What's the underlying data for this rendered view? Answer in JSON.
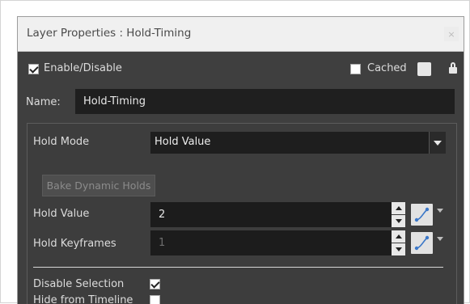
{
  "dialog": {
    "title": "Layer Properties : Hold-Timing",
    "close_label": "×"
  },
  "enable": {
    "label": "Enable/Disable",
    "checked": true
  },
  "cached": {
    "label": "Cached",
    "checked": false
  },
  "name": {
    "label": "Name:",
    "value": "Hold-Timing"
  },
  "hold_mode": {
    "label": "Hold Mode",
    "value": "Hold Value"
  },
  "bake_button": {
    "label": "Bake Dynamic Holds"
  },
  "hold_value": {
    "label": "Hold Value",
    "value": "2"
  },
  "hold_keyframes": {
    "label": "Hold Keyframes",
    "value": "1"
  },
  "disable_selection": {
    "label": "Disable Selection",
    "checked": true
  },
  "hide_from_timeline": {
    "label": "Hide from Timeline",
    "checked": false
  },
  "icons": {
    "lock": "lock-icon",
    "function": "function-curve-icon",
    "dropdown": "chevron-down-icon"
  },
  "colors": {
    "panel_bg": "#3f3f3f",
    "field_bg": "#1c1c1c",
    "title_bg": "#f0f0f0",
    "curve_accent": "#3c78c8"
  }
}
